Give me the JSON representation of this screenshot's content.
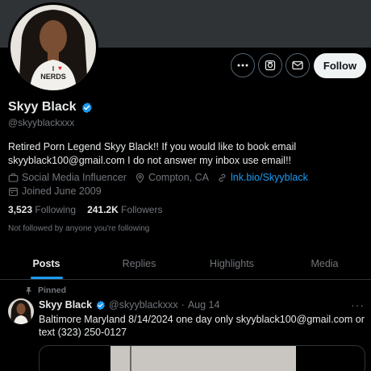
{
  "profile": {
    "display_name": "Skyy Black",
    "handle": "@skyyblackxxx",
    "bio": "Retired Porn Legend Skyy Black!! If you would like to book email skyyblack100@gmail.com I do not answer my inbox use email!!",
    "category": "Social Media Influencer",
    "location": "Compton, CA",
    "link": "lnk.bio/Skyyblack",
    "joined": "Joined June 2009",
    "shirt_text_line1": "I",
    "shirt_text_line2": "NERDS"
  },
  "actions": {
    "more_icon": "ellipsis-icon",
    "subscribe_icon": "notifications-icon",
    "message_icon": "envelope-icon",
    "follow_label": "Follow"
  },
  "stats": {
    "following_count": "3,523",
    "following_label": "Following",
    "followers_count": "241.2K",
    "followers_label": "Followers"
  },
  "not_followed_text": "Not followed by anyone you're following",
  "tabs": [
    {
      "label": "Posts",
      "active": true
    },
    {
      "label": "Replies",
      "active": false
    },
    {
      "label": "Highlights",
      "active": false
    },
    {
      "label": "Media",
      "active": false
    }
  ],
  "pinned_post": {
    "pinned_label": "Pinned",
    "name": "Skyy Black",
    "handle": "@skyyblackxxx",
    "dot": "·",
    "date": "Aug 14",
    "more": "···",
    "text": "Baltimore Maryland 8/14/2024 one day only skyyblack100@gmail.com or text (323) 250-0127"
  },
  "colors": {
    "background": "#000000",
    "accent": "#1d9bf0",
    "text_primary": "#e7e9ea",
    "text_secondary": "#71767b",
    "border": "#2f3336"
  }
}
